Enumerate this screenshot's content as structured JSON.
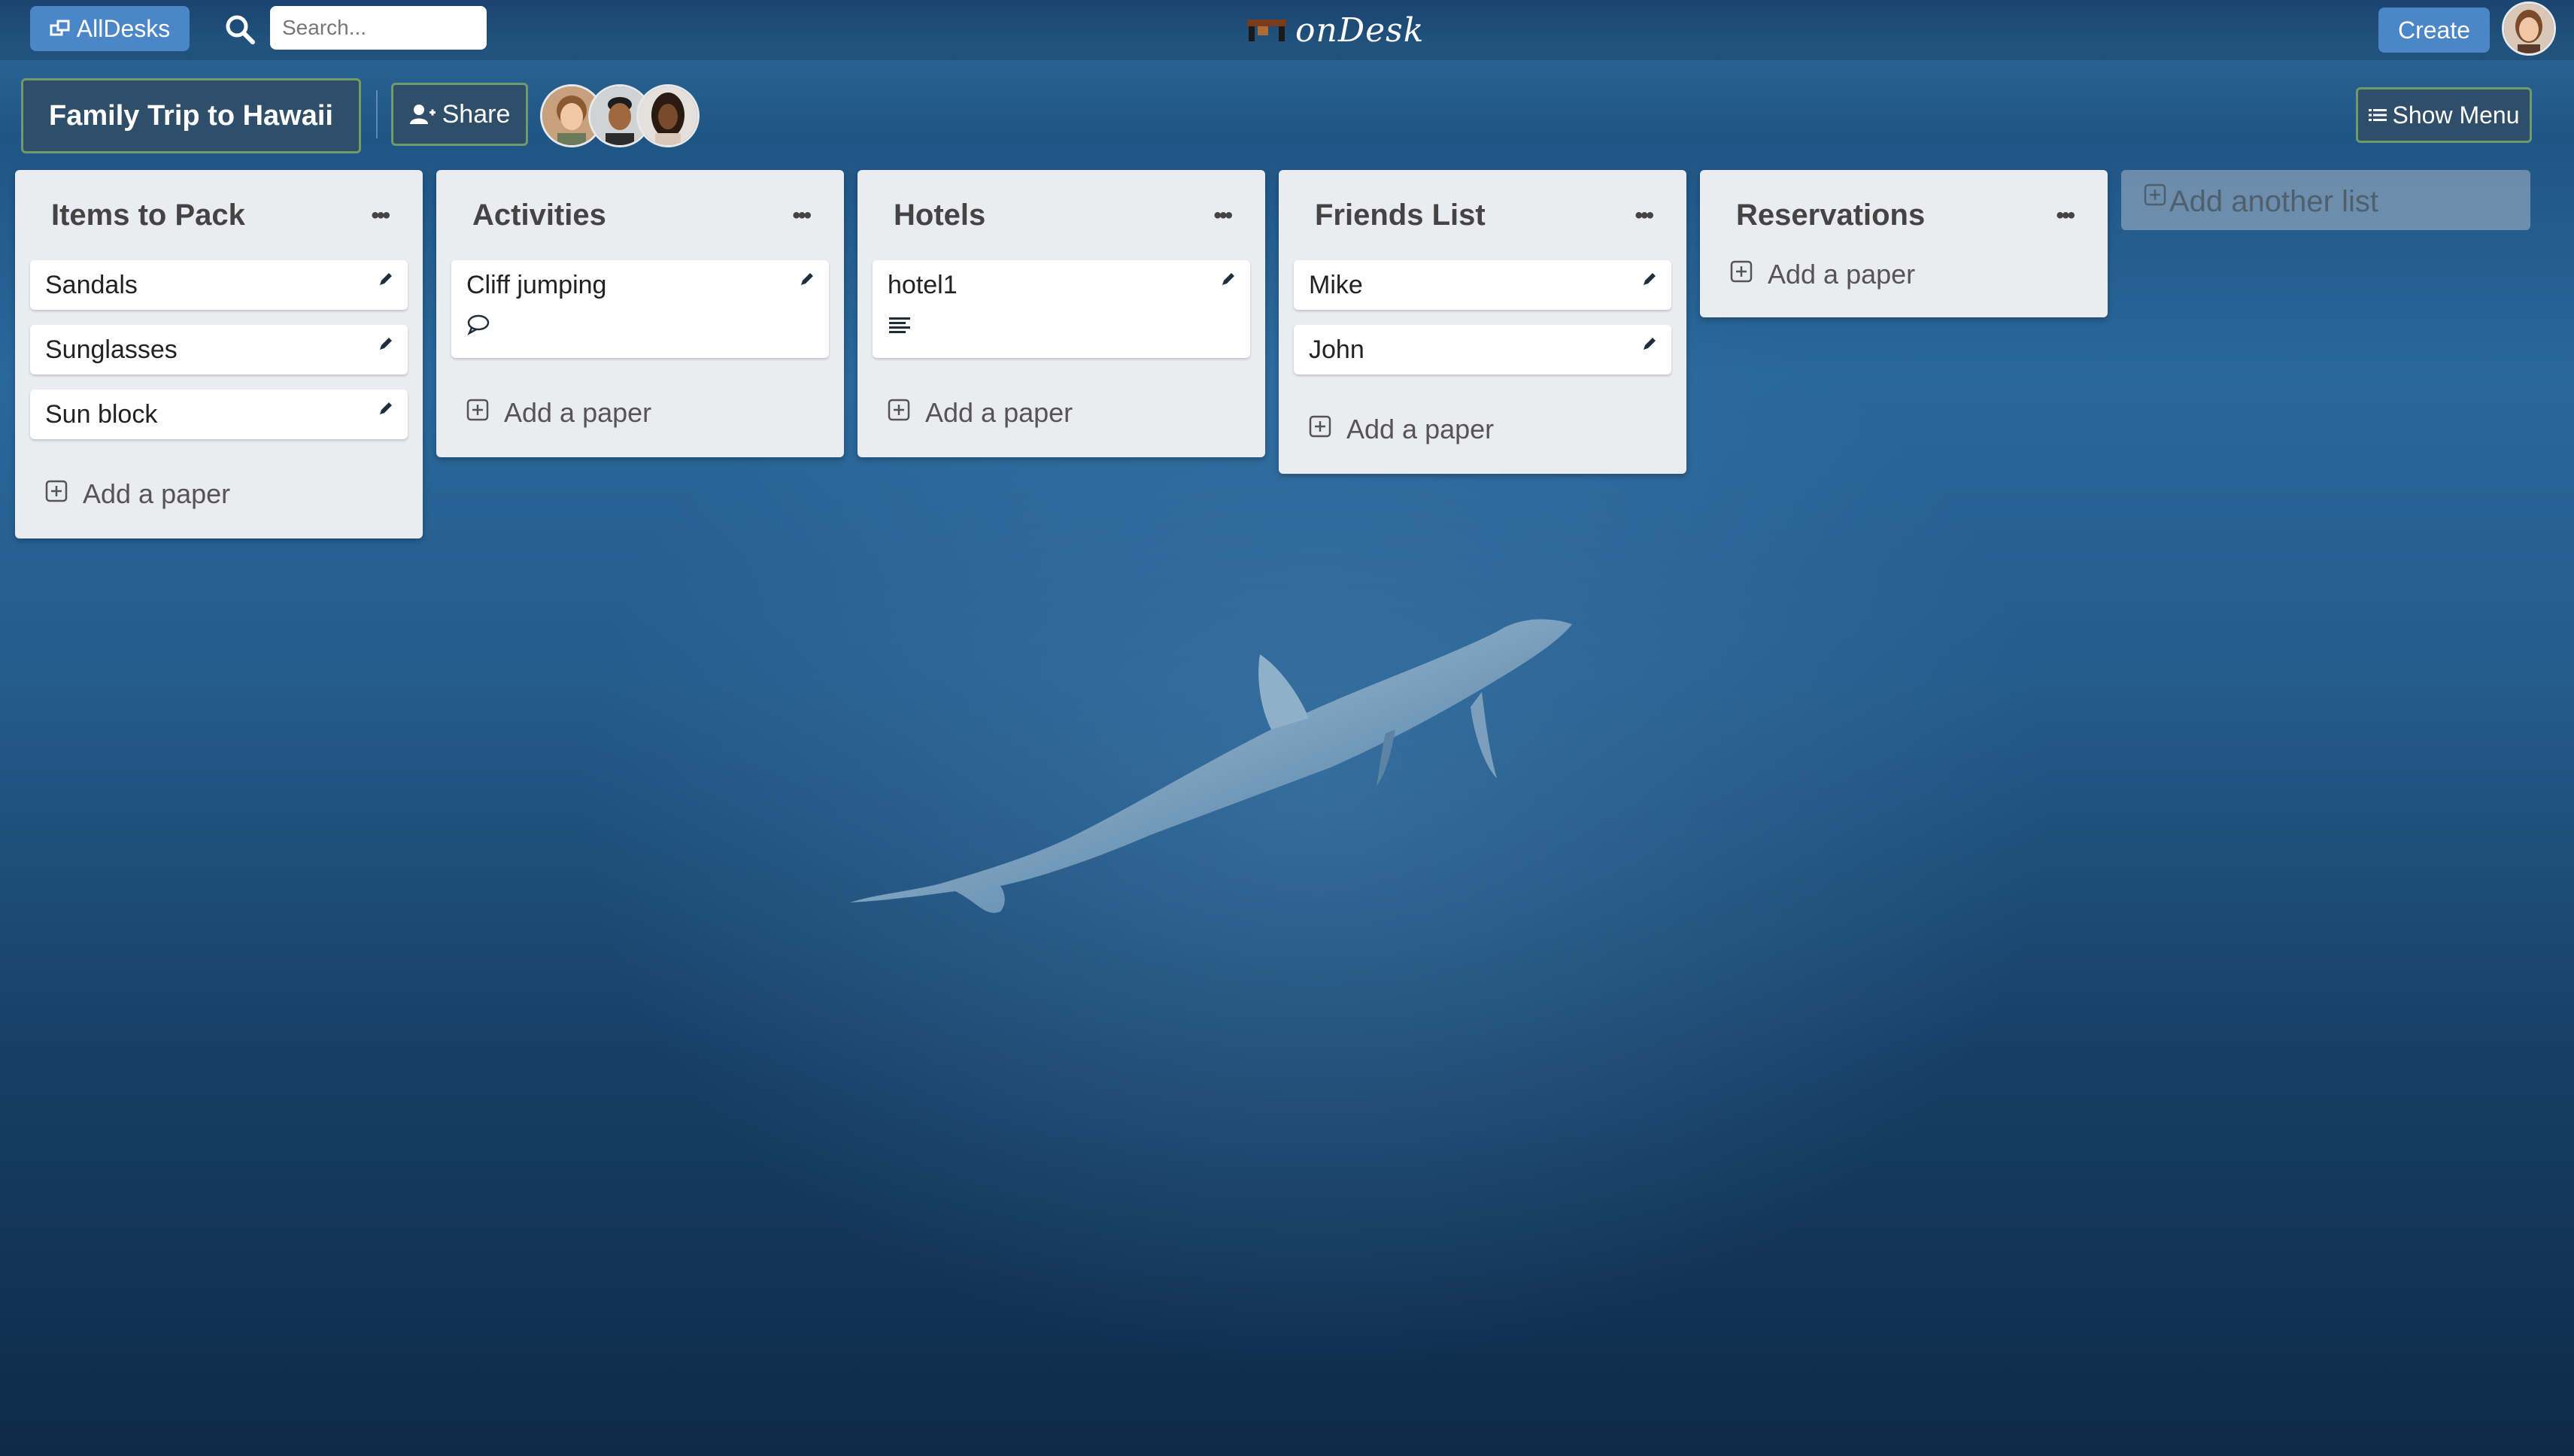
{
  "header": {
    "alldesks_label": "AllDesks",
    "search_placeholder": "Search...",
    "logo_text": "onDesk",
    "create_label": "Create"
  },
  "board": {
    "title": "Family Trip to Hawaii",
    "share_label": "Share",
    "show_menu_label": "Show Menu",
    "add_list_label": "Add another list"
  },
  "lists": [
    {
      "title": "Items to Pack",
      "cards": [
        "Sandals",
        "Sunglasses",
        "Sun block"
      ],
      "add_label": "Add a paper"
    },
    {
      "title": "Activities",
      "cards": [
        "Cliff jumping"
      ],
      "add_label": "Add a paper"
    },
    {
      "title": "Hotels",
      "cards": [
        "hotel1"
      ],
      "add_label": "Add a paper"
    },
    {
      "title": "Friends List",
      "cards": [
        "Mike",
        "John"
      ],
      "add_label": "Add a paper"
    },
    {
      "title": "Reservations",
      "cards": [],
      "add_label": "Add a paper"
    }
  ],
  "icons": {
    "menu": "more-horizontal-icon",
    "edit": "pencil-icon",
    "comment": "comment-icon",
    "description": "text-lines-icon",
    "add": "plus-square-icon"
  },
  "colors": {
    "accent": "#4a86c8",
    "board_button": "#2f4e6a",
    "list_bg": "#ebecf0"
  }
}
